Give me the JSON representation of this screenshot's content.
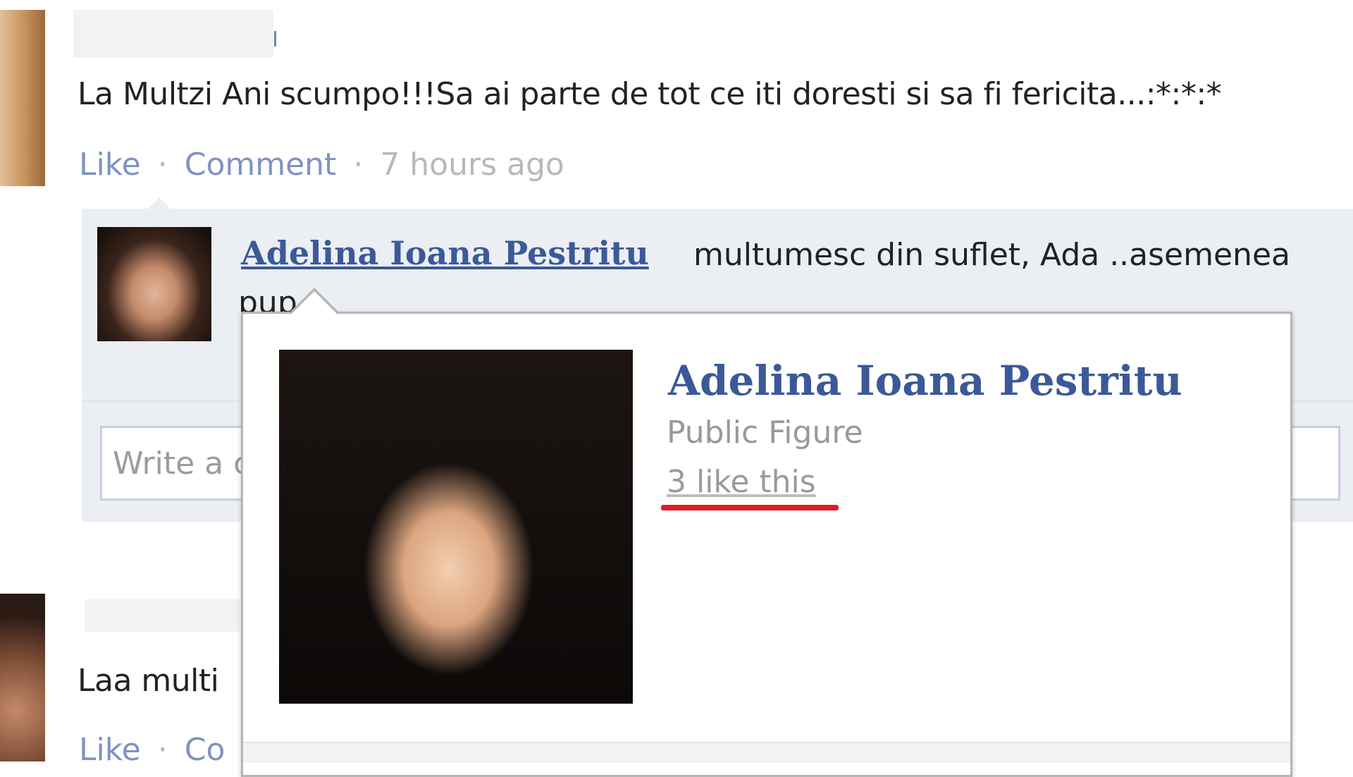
{
  "post1": {
    "text": "La Multzi Ani scumpo!!!Sa ai parte de tot ce iti doresti si sa fi fericita...:*:*:*",
    "actions": {
      "like": "Like",
      "comment": "Comment",
      "separator": "·",
      "time": "7 hours ago"
    }
  },
  "comment": {
    "author": "Adelina Ioana Pestritu",
    "text": "multumesc din suflet, Ada ..asemenea",
    "text_continued": "pup",
    "write_placeholder": "Write a comment..."
  },
  "hovercard": {
    "name": "Adelina Ioana Pestritu",
    "category": "Public Figure",
    "likes": "3 like this",
    "highlight_color": "#e01b24"
  },
  "post2": {
    "text": "Laa multi",
    "actions": {
      "like": "Like",
      "separator": "·",
      "comment_partial": "Co"
    }
  },
  "colors": {
    "link_blue": "#3b5998",
    "muted_link": "#7f93bf",
    "comment_bg": "#ebeef3"
  }
}
